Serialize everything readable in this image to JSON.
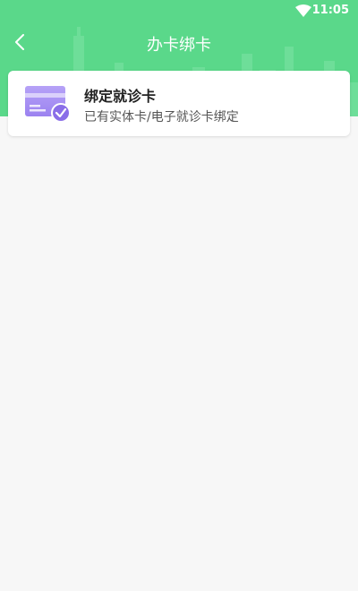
{
  "status_bar": {
    "time": "11:05"
  },
  "nav": {
    "title": "办卡绑卡"
  },
  "card": {
    "title": "绑定就诊卡",
    "subtitle": "已有实体卡/电子就诊卡绑定"
  },
  "colors": {
    "header_bg": "#5ad88a",
    "card_icon": "#9b82f0",
    "page_bg": "#f7f7f7"
  }
}
